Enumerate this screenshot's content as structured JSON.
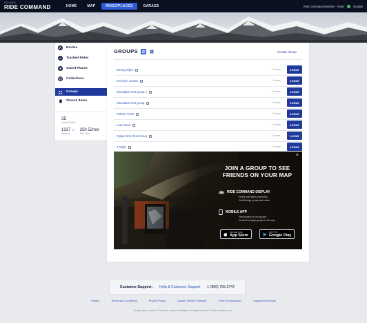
{
  "app": {
    "brand_top": "POLARIS",
    "brand_name": "RIDE COMMAND"
  },
  "nav": {
    "items": [
      {
        "label": "HOME",
        "active": false
      },
      {
        "label": "MAP",
        "active": false
      },
      {
        "label": "RIDES/PLACES",
        "active": true
      },
      {
        "label": "GARAGE",
        "active": false
      }
    ],
    "user_text": "Ride Command Member · Rider",
    "status_color": "#4cc26a",
    "language": "English"
  },
  "sidebar": {
    "items": [
      {
        "label": "Routes",
        "icon": "route-icon"
      },
      {
        "label": "Tracked Rides",
        "icon": "tracked-rides-icon"
      },
      {
        "label": "Saved Places",
        "icon": "map-pin-icon"
      },
      {
        "label": "Collections",
        "icon": "collections-icon"
      },
      {
        "label": "Groups",
        "icon": "groups-icon",
        "active": true
      },
      {
        "label": "Shared Items",
        "icon": "share-icon"
      }
    ],
    "stats": {
      "tracked_rides_count": "35",
      "tracked_rides_label": "Tracked Rides",
      "distance_value": "1237",
      "distance_unit": "mi",
      "distance_label": "Distance",
      "ride_time_value": "25h 52min",
      "ride_time_label": "Ride Time"
    }
  },
  "groups": {
    "title": "GROUPS",
    "create_label": "Create Group",
    "leave_label": "Leave",
    "list": [
      {
        "name": "Wrong Right",
        "members": "2 riders"
      },
      {
        "name": "test from Jordan",
        "members": "2 riders"
      },
      {
        "name": "Simulation test group 2",
        "members": "3 riders"
      },
      {
        "name": "Simulation test group",
        "members": "3 riders"
      },
      {
        "name": "Polaris TC4X",
        "members": "2 riders"
      },
      {
        "name": "Lost found",
        "members": "2 riders"
      },
      {
        "name": "Ogilvy Dirty Test Group",
        "members": "3 riders"
      },
      {
        "name": "4 Right",
        "members": "2 riders"
      }
    ]
  },
  "promo": {
    "title_line1": "JOIN A GROUP TO SEE",
    "title_line2": "FRIENDS ON YOUR MAP",
    "section1_title": "RIDE COMMAND DISPLAY",
    "section1_bullets": [
      "Vehicle with tablet connection",
      "Join/Manage groups and routes"
    ],
    "section2_title": "MOBILE APP",
    "section2_bullets": [
      "View location of your groups",
      "Create & manage groups on the map"
    ],
    "appstore_small": "Download on the",
    "appstore_large": "App Store",
    "googleplay_small": "GET IT ON",
    "googleplay_large": "Google Play"
  },
  "footer": {
    "support_label": "Customer Support:",
    "support_link": "Help & Customer Support",
    "support_phone": "1 (800) 765-2747",
    "links": [
      "Polaris",
      "Terms and Conditions",
      "Privacy Policy",
      "Update Vehicle Software",
      "Child Tool Manager",
      "Supported Devices"
    ],
    "copyright": "Always wear a helmet. Polaris Inc. and/or its affiliates. All rights reserved. Polaris Industries, Inc."
  }
}
